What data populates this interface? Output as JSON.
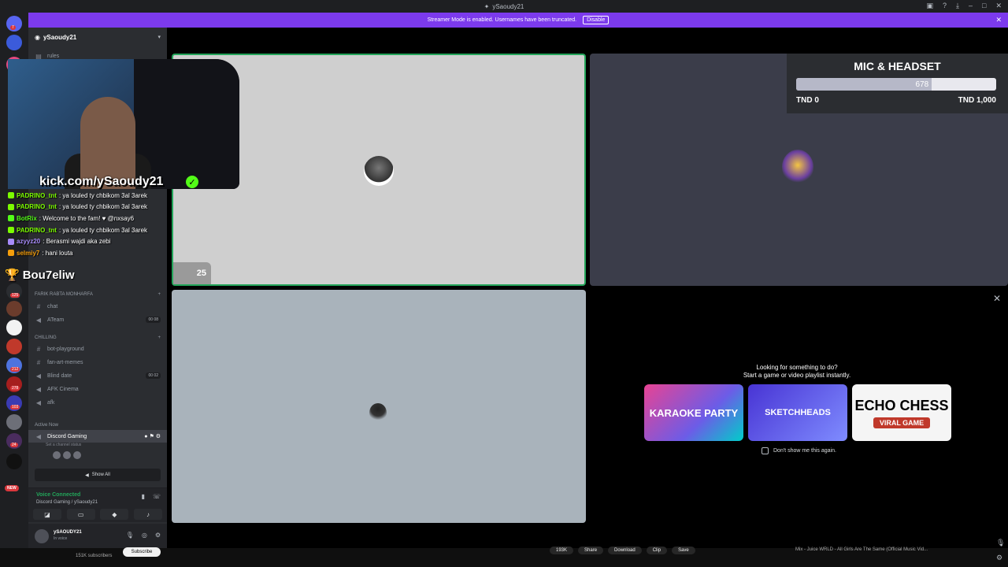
{
  "window": {
    "title": "ySaoudy21"
  },
  "banner": {
    "text": "Streamer Mode is enabled. Usernames have been truncated.",
    "disable_label": "Disable"
  },
  "server": {
    "name": "ySaoudy21"
  },
  "channels_top": [
    {
      "name": "rules",
      "type": "text"
    }
  ],
  "categories": [
    {
      "name": "FARIK RABTA MONHARFA",
      "channels": [
        {
          "name": "chat",
          "type": "text"
        },
        {
          "name": "ATeam",
          "type": "voice",
          "pill": "00 08"
        }
      ]
    },
    {
      "name": "CHILLING",
      "channels": [
        {
          "name": "bot-playground",
          "type": "text"
        },
        {
          "name": "fan-art-memes",
          "type": "text"
        },
        {
          "name": "Blind date",
          "type": "voice",
          "pill": "00 02"
        },
        {
          "name": "AFK Cinema",
          "type": "voice"
        },
        {
          "name": "afk",
          "type": "voice"
        }
      ]
    }
  ],
  "active_now": {
    "label": "Active Now",
    "channel": "Discord Gaming",
    "status_placeholder": "Set a channel status",
    "show_all": "Show All"
  },
  "voice": {
    "connected_label": "Voice Connected",
    "location": "Discord Gaming / ySaoudy21"
  },
  "user": {
    "name": "ySAOUDY21",
    "status": "In voice"
  },
  "rail": {
    "badges": [
      "7",
      "125",
      "212",
      "278",
      "103",
      "24"
    ],
    "new_label": "NEW"
  },
  "tiles": {
    "count": "25"
  },
  "mic_widget": {
    "title": "MIC & HEADSET",
    "current": "678",
    "progress": 0.678,
    "min_label": "TND 0",
    "max_label": "TND 1,000"
  },
  "activity": {
    "prompt_line1": "Looking for something to do?",
    "prompt_line2": "Start a game or video playlist instantly.",
    "games": [
      {
        "name": "KARAOKE PARTY"
      },
      {
        "name": "SKETCHHEADS"
      },
      {
        "name": "ECHO CHESS",
        "tag": "VIRAL GAME"
      }
    ],
    "dont_show": "Don't show me this again."
  },
  "stream_overlay": {
    "handle": "kick.com/ySaoudy21",
    "brand": "Bou7eliw",
    "chat": [
      {
        "user": "PADRINO_tnt",
        "msg": ": ya louled ty chbikom 3al 3arek",
        "color": "#7CFC00"
      },
      {
        "user": "PADRINO_tnt",
        "msg": ": ya louled ty chbikom 3al 3arek",
        "color": "#7CFC00"
      },
      {
        "user": "BotRix",
        "msg": ": Welcome to the fam! ♥ @nxsay6",
        "color": "#53fc18"
      },
      {
        "user": "PADRINO_tnt",
        "msg": ": ya louled ty chbikom 3al 3arek",
        "color": "#7CFC00"
      },
      {
        "user": "azyyz20",
        "msg": ": Berasmi wajdi aka zebi",
        "color": "#a78bfa"
      },
      {
        "user": "selmiy7",
        "msg": ": hani louta",
        "color": "#f59e0b"
      }
    ]
  },
  "youtube": {
    "subscribers": "151K subscribers",
    "subscribe": "Subscribe",
    "likes": "193K",
    "share": "Share",
    "download": "Download",
    "clip": "Clip",
    "save": "Save",
    "next_title": "Mix - Juice WRLD - All Girls Are The Same (Official Music Vid..."
  }
}
